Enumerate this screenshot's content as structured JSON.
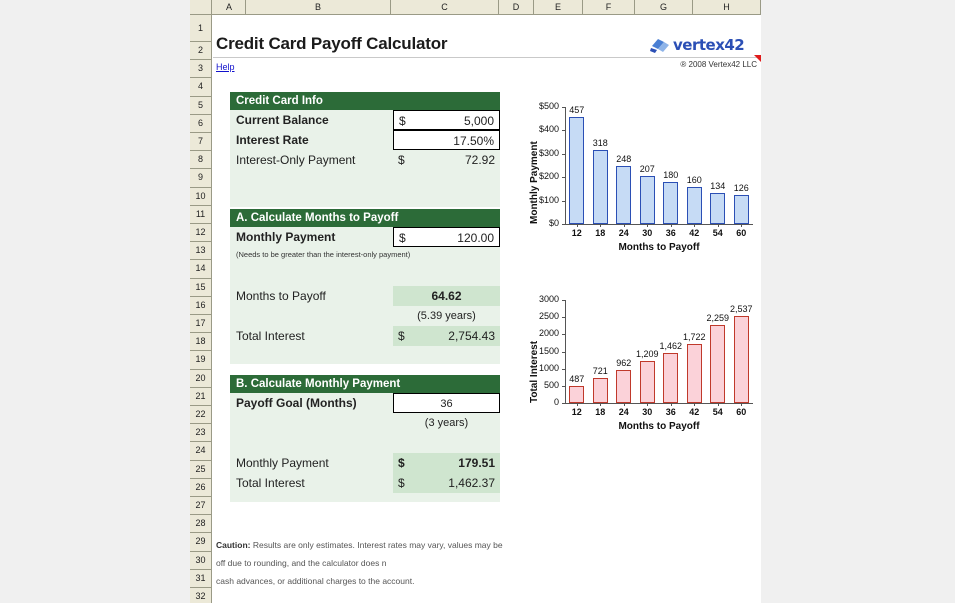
{
  "app": {
    "title": "Credit Card Payoff Calculator",
    "help_label": "Help",
    "copyright": "® 2008 Vertex42 LLC",
    "logo_text": "vertex42"
  },
  "grid": {
    "columns": [
      "A",
      "B",
      "C",
      "D",
      "E",
      "F",
      "G",
      "H"
    ],
    "rows": [
      "1",
      "2",
      "3",
      "4",
      "5",
      "6",
      "7",
      "8",
      "9",
      "10",
      "11",
      "12",
      "13",
      "14",
      "15",
      "16",
      "17",
      "18",
      "19",
      "20",
      "21",
      "22",
      "23",
      "24",
      "25",
      "26",
      "27",
      "28",
      "29",
      "30",
      "31",
      "32"
    ]
  },
  "info_panel": {
    "header": "Credit Card Info",
    "rows": [
      {
        "label": "Current Balance",
        "dollar": "$",
        "value": "5,000"
      },
      {
        "label": "Interest Rate",
        "dollar": "",
        "value": "17.50%"
      },
      {
        "label": "Interest-Only Payment",
        "dollar": "$",
        "value": "72.92"
      }
    ]
  },
  "section_a": {
    "header": "A.  Calculate Months to Payoff",
    "payment_label": "Monthly Payment",
    "payment_dollar": "$",
    "payment_value": "120.00",
    "note": "(Needs to be greater than the interest-only payment)",
    "months_label": "Months to Payoff",
    "months_value": "64.62",
    "years_value": "(5.39 years)",
    "interest_label": "Total Interest",
    "interest_dollar": "$",
    "interest_value": "2,754.43"
  },
  "section_b": {
    "header": "B.  Calculate Monthly Payment",
    "goal_label": "Payoff Goal (Months)",
    "goal_value": "36",
    "years_value": "(3 years)",
    "payment_label": "Monthly Payment",
    "payment_dollar": "$",
    "payment_value": "179.51",
    "interest_label": "Total Interest",
    "interest_dollar": "$",
    "interest_value": "1,462.37"
  },
  "caution": {
    "bold": "Caution:",
    "line1": " Results are only estimates. Interest rates may vary, values may be",
    "line2": "off due to rounding, and the calculator does n",
    "line3": "cash advances, or additional charges to the account."
  },
  "colors": {
    "header_green": "#2c6b38",
    "panel_green": "#e9f2e9",
    "result_green": "#cfe5cf",
    "bar_blue_fill": "#c6dbf5",
    "bar_blue_border": "#2b4fb5",
    "bar_pink_fill": "#fbd2d9",
    "bar_pink_border": "#c0392b",
    "link_blue": "#1111cc"
  },
  "chart_data": [
    {
      "type": "bar",
      "title": "",
      "xlabel": "Months to Payoff",
      "ylabel": "Monthly Payment",
      "categories": [
        "12",
        "18",
        "24",
        "30",
        "36",
        "42",
        "54",
        "60"
      ],
      "values": [
        457,
        318,
        248,
        207,
        180,
        160,
        134,
        126
      ],
      "labels": [
        "457",
        "318",
        "248",
        "207",
        "180",
        "160",
        "134",
        "126"
      ],
      "yticks": [
        "$0",
        "$100",
        "$200",
        "$300",
        "$400",
        "$500"
      ],
      "ytickvals": [
        0,
        100,
        200,
        300,
        400,
        500
      ],
      "ylim": [
        0,
        500
      ],
      "grid": false,
      "legend": false,
      "series_color": "#c6dbf5"
    },
    {
      "type": "bar",
      "title": "",
      "xlabel": "Months to Payoff",
      "ylabel": "Total Interest",
      "categories": [
        "12",
        "18",
        "24",
        "30",
        "36",
        "42",
        "54",
        "60"
      ],
      "values": [
        487,
        721,
        962,
        1209,
        1462,
        1722,
        2259,
        2537
      ],
      "labels": [
        "487",
        "721",
        "962",
        "1,209",
        "1,462",
        "1,722",
        "2,259",
        "2,537"
      ],
      "yticks": [
        "0",
        "500",
        "1000",
        "1500",
        "2000",
        "2500",
        "3000"
      ],
      "ytickvals": [
        0,
        500,
        1000,
        1500,
        2000,
        2500,
        3000
      ],
      "ylim": [
        0,
        3000
      ],
      "grid": false,
      "legend": false,
      "series_color": "#fbd2d9"
    }
  ]
}
